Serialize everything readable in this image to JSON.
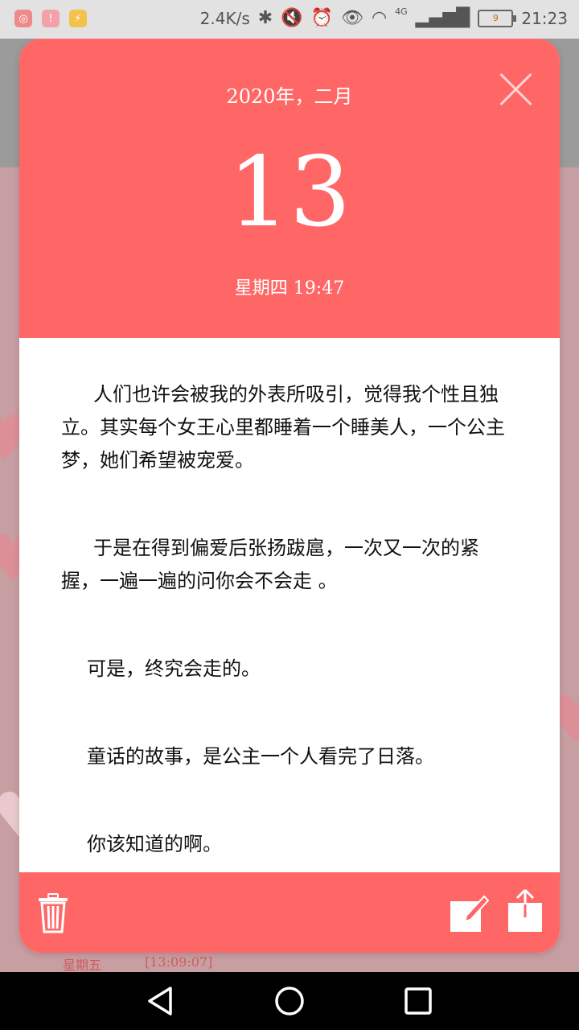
{
  "status_bar": {
    "net_speed": "2.4K/s",
    "network": "4G",
    "battery": "9",
    "time": "21:23",
    "left_icons": [
      "timer-app-icon",
      "alert-app-icon",
      "charging-app-icon"
    ],
    "right_icons": [
      "bluetooth-icon",
      "mute-icon",
      "alarm-icon",
      "eye-icon",
      "wifi-icon",
      "signal-icon",
      "battery-icon"
    ]
  },
  "date_card": {
    "month_label": "2020年，二月",
    "day": "13",
    "weekday_time": "星期四 19:47"
  },
  "note": {
    "paragraphs": [
      "人们也许会被我的外表所吸引，觉得我个性且独立。其实每个女王心里都睡着一个睡美人，一个公主梦，她们希望被宠爱。",
      "于是在得到偏爱后张扬跋扈，一次又一次的紧握，一遍一遍的问你会不会走 。",
      "可是，终究会走的。",
      "童话的故事，是公主一个人看完了日落。",
      "你该知道的啊。"
    ]
  },
  "background": {
    "weekday": "星期五",
    "time": "[13:09:07]"
  },
  "colors": {
    "accent": "#ff6767",
    "status_bar": "#e2e2e2",
    "nav_bar": "#000000"
  }
}
